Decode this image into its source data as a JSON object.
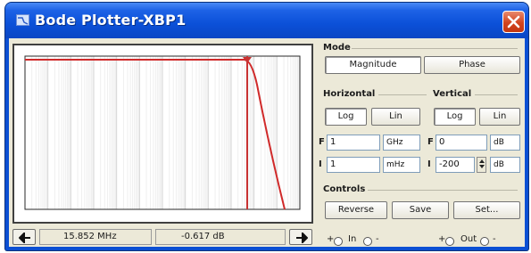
{
  "window": {
    "title": "Bode Plotter-XBP1"
  },
  "status": {
    "frequency": "15.852 MHz",
    "value": "-0.617 dB"
  },
  "mode": {
    "label": "Mode",
    "magnitude": "Magnitude",
    "phase": "Phase"
  },
  "horizontal": {
    "label": "Horizontal",
    "log": "Log",
    "lin": "Lin",
    "f_label": "F",
    "f_value": "1",
    "f_unit": "GHz",
    "i_label": "I",
    "i_value": "1",
    "i_unit": "mHz"
  },
  "vertical": {
    "label": "Vertical",
    "log": "Log",
    "lin": "Lin",
    "f_label": "F",
    "f_value": "0",
    "f_unit": "dB",
    "i_label": "I",
    "i_value": "-200",
    "i_unit": "dB"
  },
  "controls": {
    "label": "Controls",
    "reverse": "Reverse",
    "save": "Save",
    "set": "Set..."
  },
  "terminals": {
    "in_label": "In",
    "out_label": "Out",
    "plus": "+",
    "minus": "-"
  },
  "chart_data": {
    "type": "line",
    "title": "",
    "xlabel": "",
    "ylabel": "",
    "x_scale": "log",
    "grid": true,
    "series": [
      {
        "x": [
          "1 mHz",
          "10 MHz",
          "15.852 MHz",
          "30 MHz",
          "60 MHz"
        ],
        "y": [
          0,
          0,
          -0.617,
          -60,
          -200
        ]
      }
    ]
  },
  "colors": {
    "trace": "#d02a2a",
    "cursor": "#c83232",
    "title_bar": "#0b50d8",
    "close": "#d2441f"
  },
  "icons": {
    "app": "bode-plotter-icon",
    "close": "close-icon",
    "left": "arrow-left-icon",
    "right": "arrow-right-icon"
  }
}
